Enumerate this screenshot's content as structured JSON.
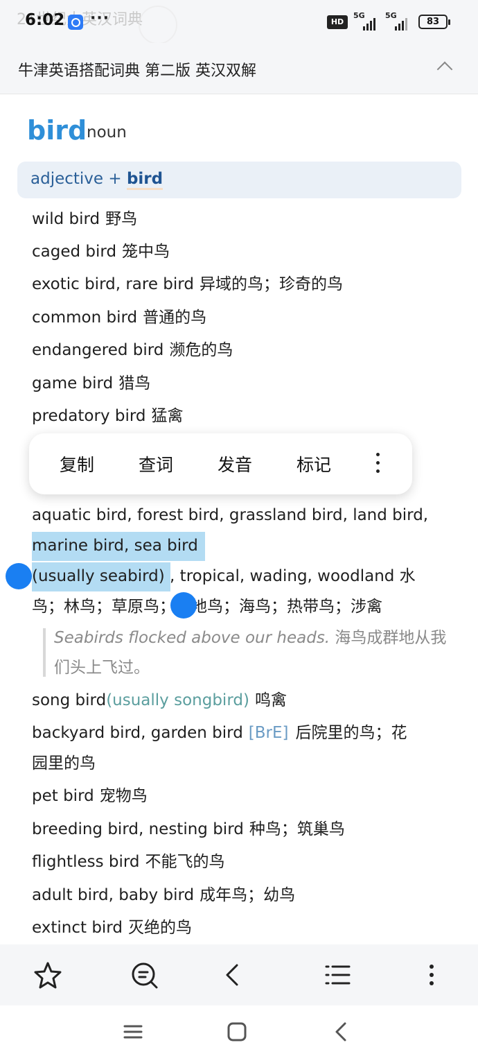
{
  "status_bar": {
    "ghost_text": "21世纪大英汉词典",
    "time": "6:02",
    "dots": "···",
    "hd_label": "HD",
    "network_1": "5G",
    "network_2": "5G",
    "battery": "83"
  },
  "title_bar": {
    "title": "牛津英语搭配词典 第二版 英汉双解"
  },
  "entry": {
    "headword": "bird",
    "pos": "noun"
  },
  "section": {
    "prefix": "adjective + ",
    "keyword": "bird"
  },
  "collocations_top": [
    {
      "en": "wild bird",
      "cn": "野鸟"
    },
    {
      "en": "caged bird",
      "cn": "笼中鸟"
    },
    {
      "en": "exotic bird, rare bird",
      "cn": "异域的鸟；珍奇的鸟"
    },
    {
      "en": "common bird",
      "cn": "普通的鸟"
    },
    {
      "en": "endangered bird",
      "cn": "濒危的鸟"
    },
    {
      "en": "game bird",
      "cn": "猎鸟"
    },
    {
      "en": "predatory bird",
      "cn": "猛禽"
    }
  ],
  "context_menu": {
    "copy": "复制",
    "lookup": "查词",
    "pronounce": "发音",
    "mark": "标记"
  },
  "selected_entry": {
    "line1": "aquatic bird, forest bird, grassland bird, land bird,",
    "line2": "marine bird, sea bird",
    "line3_sel": "(usually seabird)",
    "line3_rest": " , tropical, wading, woodland 水",
    "line4": "鸟；林鸟；草原鸟；陆地鸟；海鸟；热带鸟；涉禽"
  },
  "example": {
    "en": "Seabirds flocked above our heads.",
    "cn": " 海鸟成群地从我们头上飞过。"
  },
  "collocations_bottom": [
    {
      "en": "song bird",
      "variant": "(usually songbird)",
      "cn": "鸣禽"
    },
    {
      "en": "backyard bird, garden bird",
      "tag": "[BrE]",
      "cn": "后院里的鸟；花"
    },
    {
      "cont": "园里的鸟"
    },
    {
      "en": "pet bird",
      "cn": "宠物鸟"
    },
    {
      "en": "breeding bird, nesting bird",
      "cn": "种鸟；筑巢鸟"
    },
    {
      "en": "flightless bird",
      "cn": "不能飞的鸟"
    },
    {
      "en": "adult bird, baby bird",
      "cn": "成年鸟；幼鸟"
    },
    {
      "en": "extinct bird",
      "cn": "灭绝的鸟"
    }
  ],
  "toolbar_icons": [
    "star-icon",
    "search-chat-icon",
    "back-icon",
    "list-icon",
    "more-icon"
  ],
  "colors": {
    "headword": "#2f8fd8",
    "selection": "#b3dcf3",
    "handle": "#1a7ff2",
    "variant": "#5b9e9e"
  }
}
